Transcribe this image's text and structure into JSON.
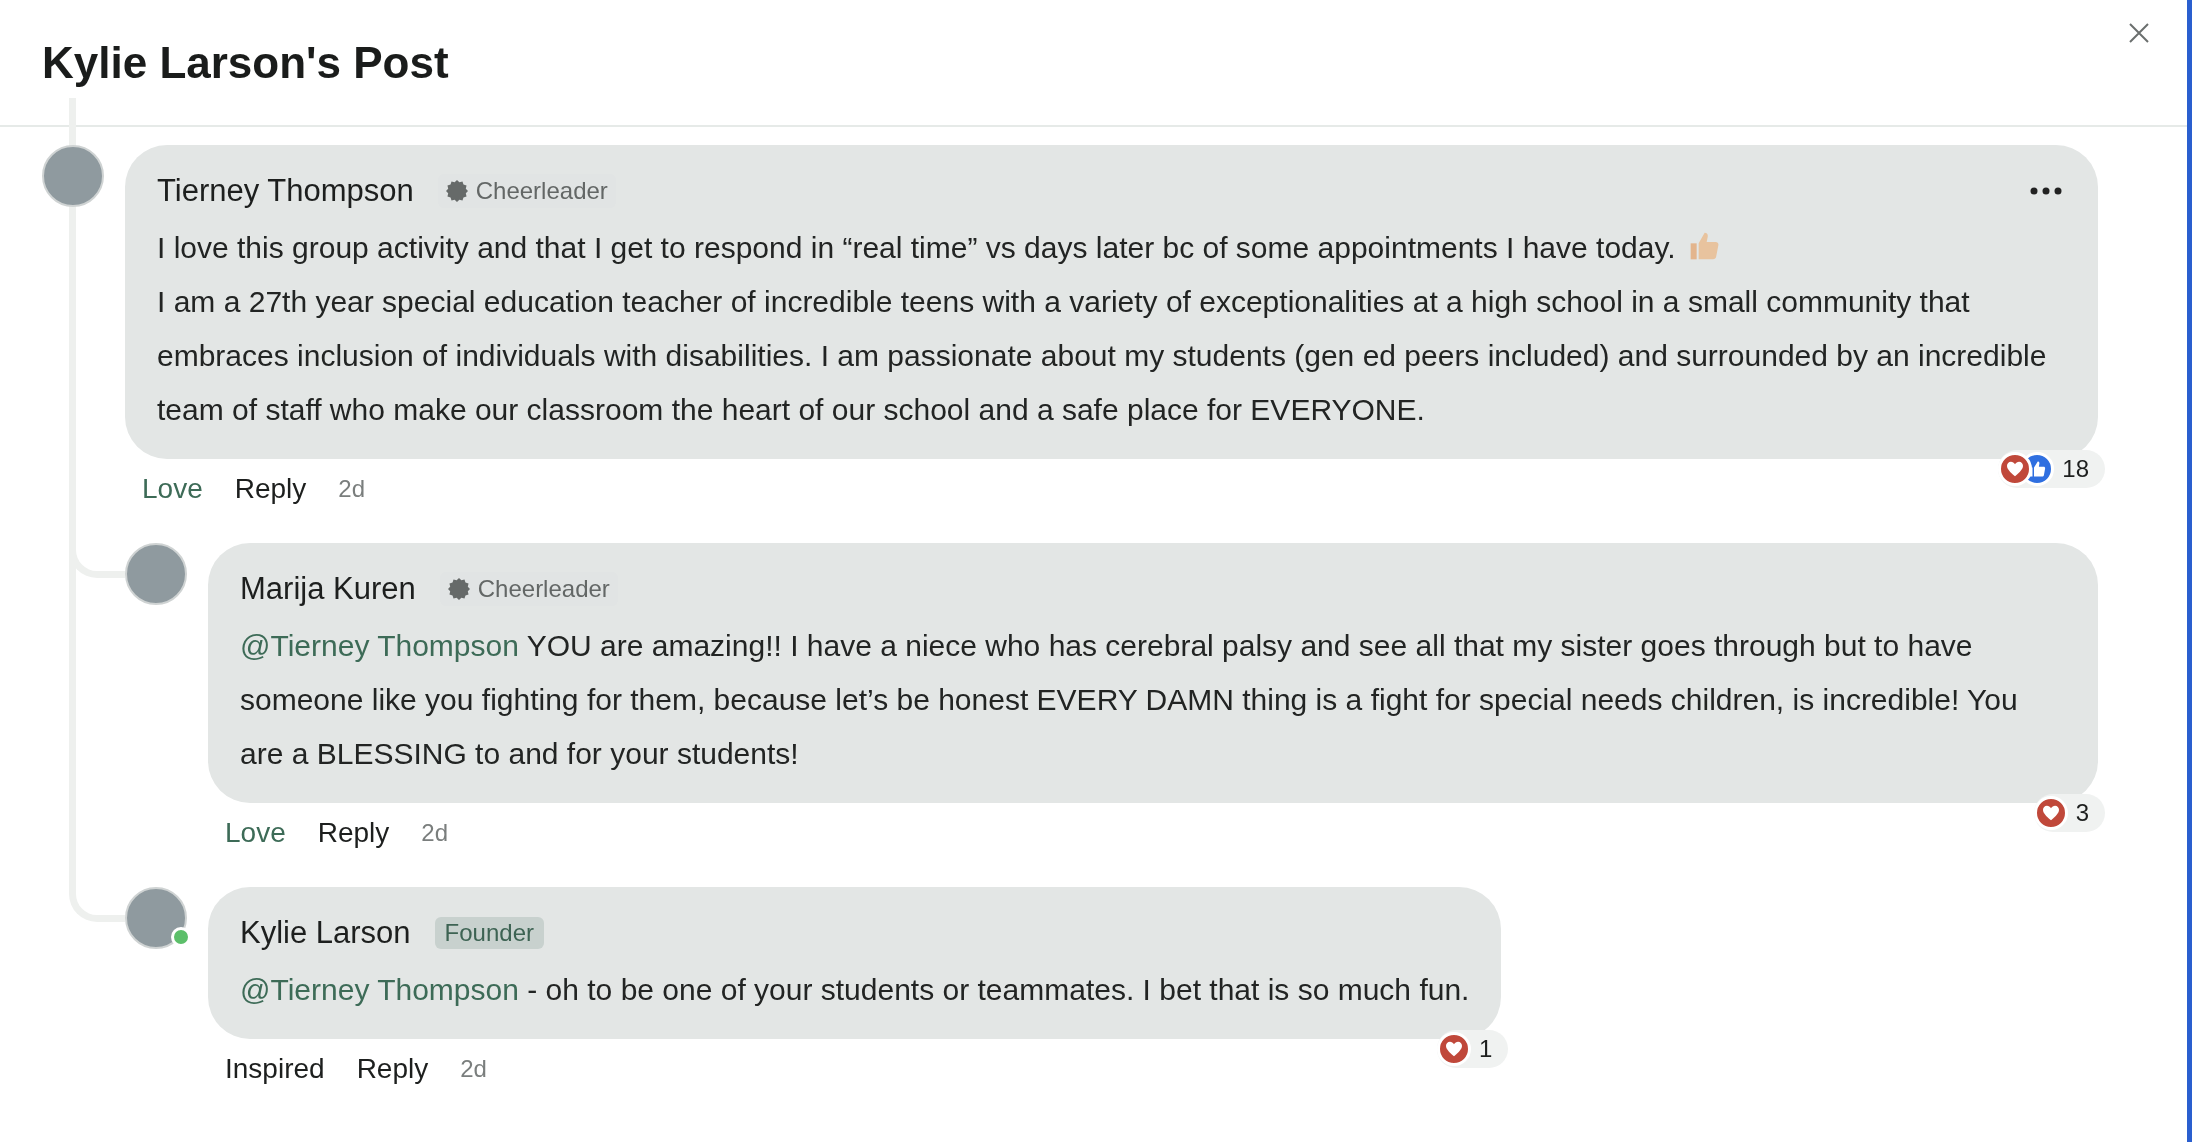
{
  "title": "Kylie Larson's Post",
  "comments": [
    {
      "author": "Tierney Thompson",
      "online": false,
      "badge": {
        "kind": "role",
        "label": "Cheerleader"
      },
      "has_menu": true,
      "paragraphs": [
        "I love this group activity and that I get to respond in “real time” vs days later bc of some appointments I have today.",
        "I am a 27th year special education teacher of incredible teens with a variety of exceptionalities at a high school in a small community that embraces inclusion of individuals with disabilities. I am passionate about my students (gen ed peers included) and surrounded by an incredible team of staff who make our classroom the heart of our school and a safe place for EVERYONE."
      ],
      "emoji": {
        "kind": "thumbs_up"
      },
      "reaction_label": "Love",
      "reacted": true,
      "reply_label": "Reply",
      "time": "2d",
      "reactions": {
        "types": [
          {
            "kind": "love"
          },
          {
            "kind": "like"
          }
        ],
        "count": "18"
      },
      "replies": [
        {
          "author": "Marija Kuren",
          "online": false,
          "badge": {
            "kind": "role",
            "label": "Cheerleader"
          },
          "has_menu": false,
          "mention": "@Tierney Thompson",
          "paragraphs": [
            "YOU are amazing!! I have a niece who has cerebral palsy and see all that my sister goes through but to have someone like you fighting for them, because let’s be honest EVERY DAMN thing is a fight for special needs children, is incredible! You are a BLESSING to and for your students!"
          ],
          "reaction_label": "Love",
          "reacted": true,
          "reply_label": "Reply",
          "time": "2d",
          "reactions": {
            "types": [
              {
                "kind": "love"
              }
            ],
            "count": "3"
          }
        },
        {
          "author": "Kylie Larson",
          "online": true,
          "badge": {
            "kind": "tag",
            "label": "Founder"
          },
          "has_menu": false,
          "mention": "@Tierney Thompson",
          "paragraphs": [
            "- oh to be one of your students or teammates. I bet that is so much fun."
          ],
          "reaction_label": "Inspired",
          "reacted": false,
          "reply_label": "Reply",
          "time": "2d",
          "reactions": {
            "types": [
              {
                "kind": "love"
              }
            ],
            "count": "1"
          }
        }
      ]
    }
  ]
}
